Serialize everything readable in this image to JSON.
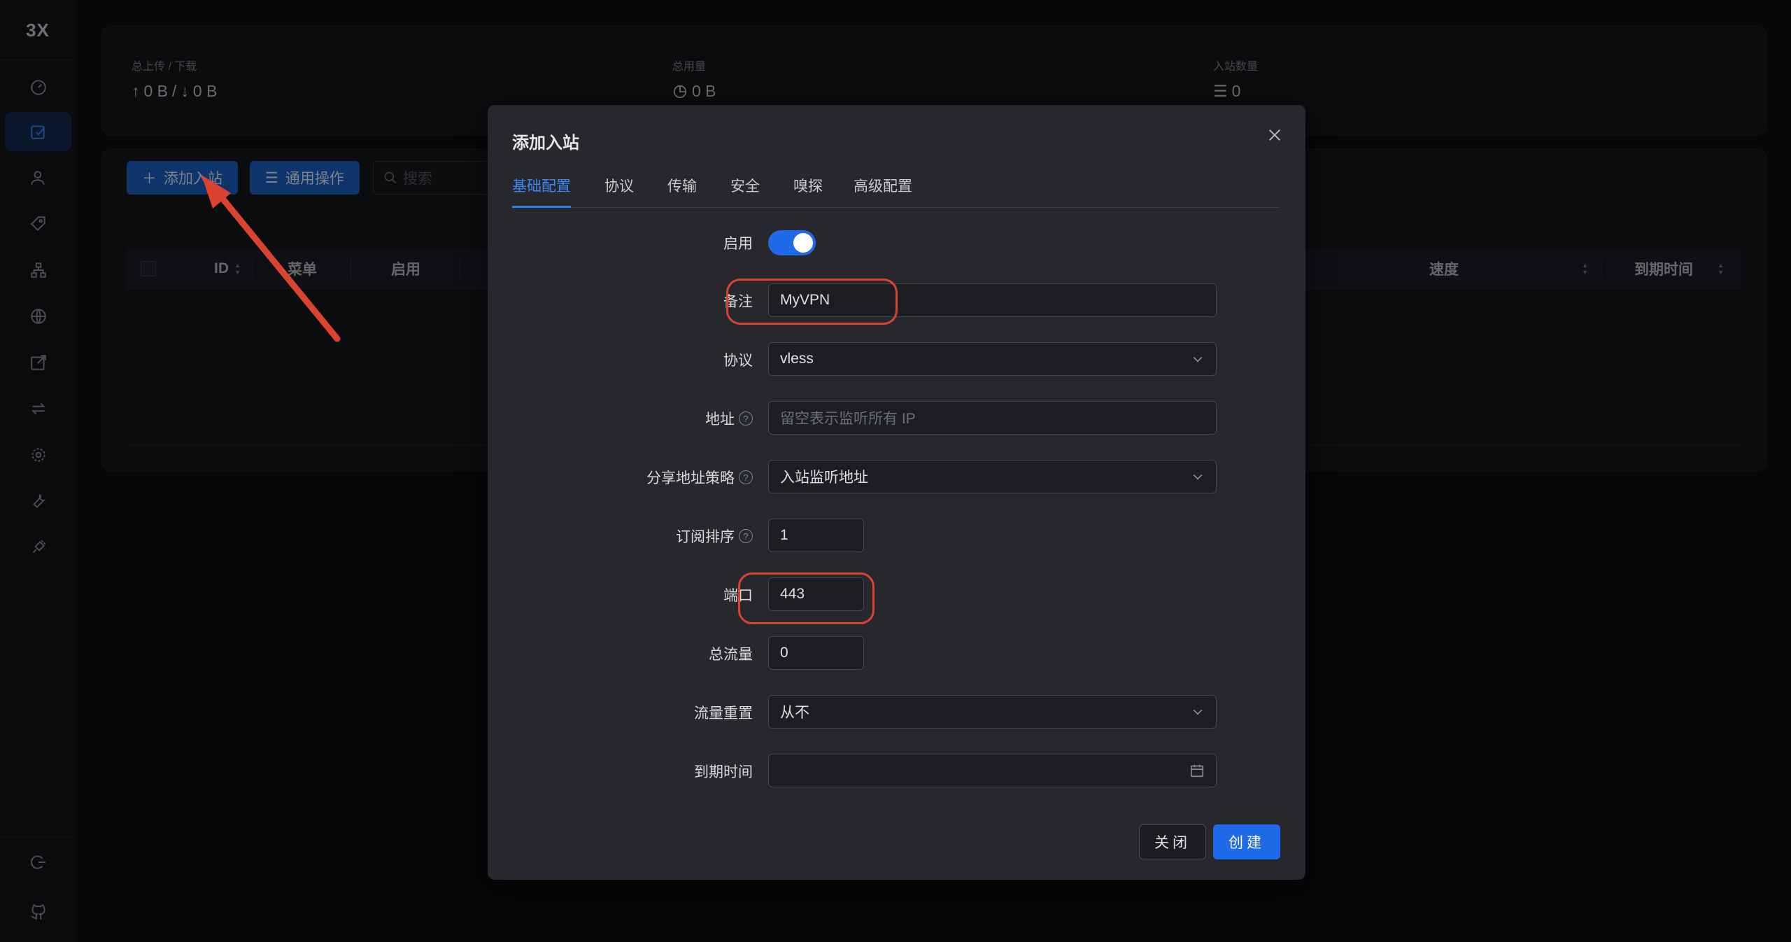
{
  "sidebar": {
    "logo": "3X",
    "items": [
      {
        "icon": "dashboard-icon",
        "active": false
      },
      {
        "icon": "inbounds-icon",
        "active": true
      },
      {
        "icon": "users-icon",
        "active": false
      },
      {
        "icon": "tag-icon",
        "active": false
      },
      {
        "icon": "network-icon",
        "active": false
      },
      {
        "icon": "globe-icon",
        "active": false
      },
      {
        "icon": "external-edit-icon",
        "active": false
      },
      {
        "icon": "swap-icon",
        "active": false
      },
      {
        "icon": "settings-icon",
        "active": false
      },
      {
        "icon": "tool-icon",
        "active": false
      },
      {
        "icon": "plugin-icon",
        "active": false
      }
    ],
    "bottom": [
      {
        "icon": "logout-icon"
      },
      {
        "icon": "github-icon"
      }
    ]
  },
  "stats": {
    "upload_download_label": "总上传 / 下载",
    "upload_download_value": "0 B / 0 B",
    "up_value": "0 B",
    "down_value": "0 B",
    "total_usage_label": "总用量",
    "total_usage_value": "0 B",
    "inbound_count_label": "入站数量",
    "inbound_count_value": "0"
  },
  "toolbar": {
    "add_inbound": "添加入站",
    "general_ops": "通用操作",
    "search_placeholder": "搜索"
  },
  "table": {
    "columns": [
      "ID",
      "菜单",
      "启用",
      "速度",
      "到期时间"
    ]
  },
  "modal": {
    "title": "添加入站",
    "tabs": [
      "基础配置",
      "协议",
      "传输",
      "安全",
      "嗅探",
      "高级配置"
    ],
    "active_tab": "基础配置",
    "fields": {
      "enable_label": "启用",
      "enabled": true,
      "remark_label": "备注",
      "remark_value": "MyVPN",
      "protocol_label": "协议",
      "protocol_value": "vless",
      "address_label": "地址",
      "address_placeholder": "留空表示监听所有 IP",
      "share_policy_label": "分享地址策略",
      "share_policy_value": "入站监听地址",
      "sub_order_label": "订阅排序",
      "sub_order_value": "1",
      "port_label": "端口",
      "port_value": "443",
      "total_traffic_label": "总流量",
      "total_traffic_value": "0",
      "traffic_reset_label": "流量重置",
      "traffic_reset_value": "从不",
      "expiry_label": "到期时间",
      "expiry_value": ""
    },
    "close_button": "关闭",
    "create_button": "创建"
  },
  "colors": {
    "accent": "#1f6ae8",
    "annotation": "#d9432f",
    "background": "#0d0e11",
    "modal": "#26282e"
  }
}
